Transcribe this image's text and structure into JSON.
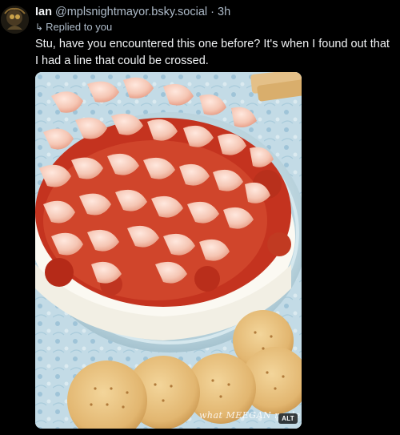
{
  "post": {
    "display_name": "Ian",
    "handle": "@mplsnightmayor.bsky.social",
    "separator": " · ",
    "timestamp": "3h",
    "reply_context": "Replied to you",
    "text": "Stu, have you encountered this one before? It's when I found out that I had a line that could be crossed."
  },
  "media": {
    "watermark": "what MEEGAN made",
    "alt_badge": "ALT"
  },
  "colors": {
    "background": "#000000",
    "text_primary": "#f1f3f5",
    "text_secondary": "#aebbc9"
  }
}
